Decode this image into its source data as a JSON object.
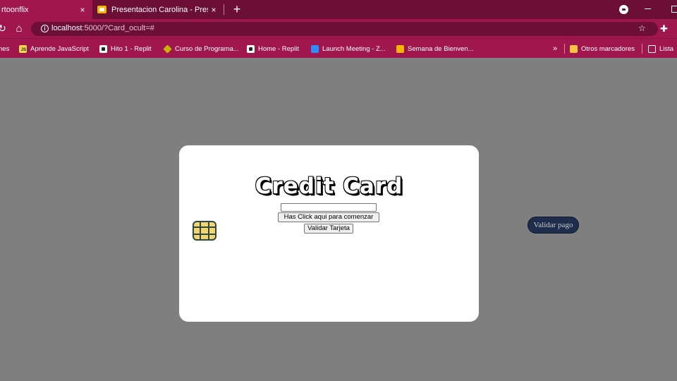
{
  "browser": {
    "tabs": [
      {
        "label": "rtoonflix",
        "close": "×",
        "active": true
      },
      {
        "label": "Presentacion Carolina - Presenta",
        "close": "×",
        "active": false
      }
    ],
    "new_tab": "+",
    "url_host": "localhost",
    "url_rest": ":5000/?Card_ocult=#",
    "bookmarks": [
      {
        "label": "nes",
        "icon": "none"
      },
      {
        "label": "Aprende JavaScript",
        "icon": "js-icon"
      },
      {
        "label": "Hito 1 - Replit",
        "icon": "replit-icon"
      },
      {
        "label": "Curso de Programa...",
        "icon": "diamond-icon"
      },
      {
        "label": "Home - Replit",
        "icon": "replit-icon"
      },
      {
        "label": "Launch Meeting - Z...",
        "icon": "meeting-icon"
      },
      {
        "label": "Semana de Bienven...",
        "icon": "slides-icon"
      }
    ],
    "bookmarks_overflow": "»",
    "other_bookmarks": "Otros marcadores",
    "reading_list": "Lista"
  },
  "card": {
    "title": "Credit Card",
    "input_value": "",
    "start_button": "Has Click aqui para comenzar",
    "validate_button": "Validar Tarjeta"
  },
  "page": {
    "pay_button": "Validar pago"
  },
  "colors": {
    "tab_bar": "#6b0f35",
    "toolbar": "#a0174e",
    "page_background": "#7f7f7f",
    "card": "#ffffff",
    "pay_button": "#1d2d4b",
    "chip": "#f6d36b"
  }
}
